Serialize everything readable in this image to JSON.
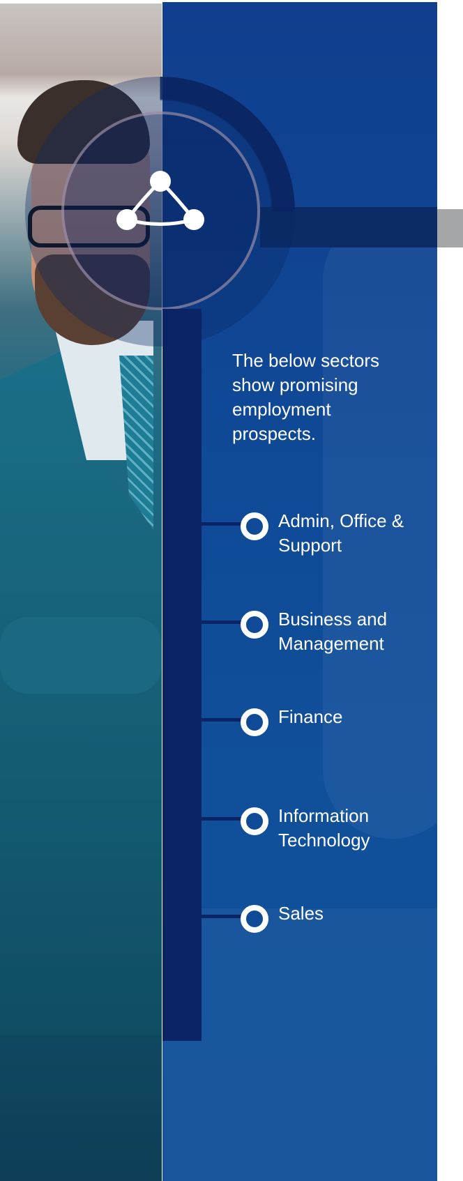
{
  "intro_text": "The below sectors show promising employment prospects.",
  "sectors": [
    {
      "label": "Admin, Office & Support"
    },
    {
      "label": "Business and Management"
    },
    {
      "label": "Finance"
    },
    {
      "label": "Information Technology"
    },
    {
      "label": "Sales"
    }
  ],
  "colors": {
    "panel_blue": "#0f4a97",
    "spine_navy": "#0a2466",
    "accent_gray": "#a5a6a8",
    "text_white": "#ffffff"
  },
  "icons": {
    "emblem": "triangle-network-icon",
    "bullet": "ring-bullet-icon"
  }
}
